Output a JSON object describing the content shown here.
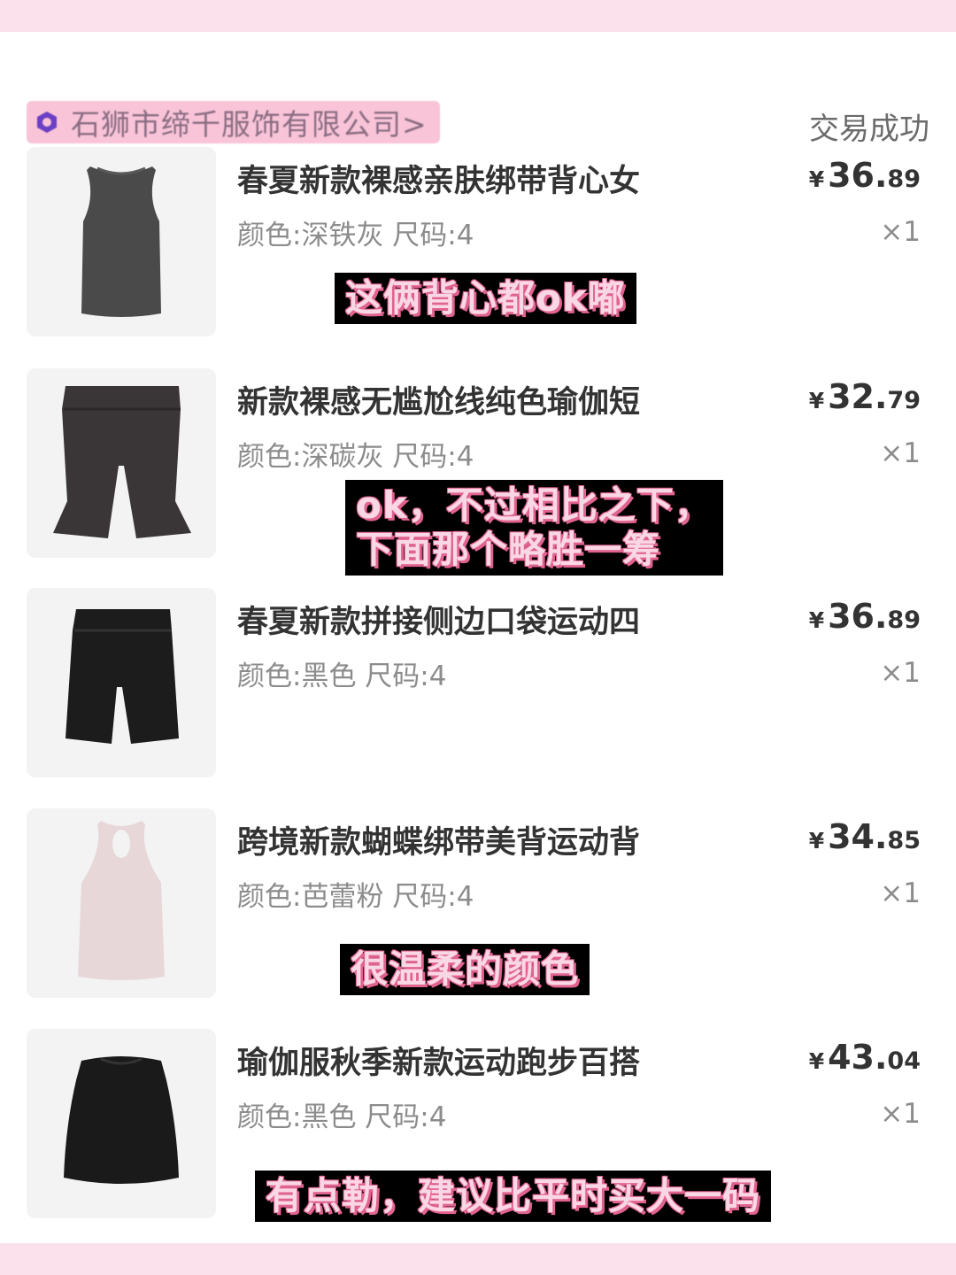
{
  "shop": {
    "name": "石狮市缔千服饰有限公司>",
    "status": "交易成功",
    "icon": "shop-icon"
  },
  "items": [
    {
      "title": "春夏新款裸感亲肤绑带背心女",
      "spec": "颜色:深铁灰 尺码:4",
      "price_symbol": "¥",
      "price_int": "36.",
      "price_dec": "89",
      "qty": "×1",
      "thumb": "tank-top-dark-gray",
      "color": "#4a4a4a"
    },
    {
      "title": "新款裸感无尴尬线纯色瑜伽短",
      "spec": "颜色:深碳灰 尺码:4",
      "price_symbol": "¥",
      "price_int": "32.",
      "price_dec": "79",
      "qty": "×1",
      "thumb": "shorts-charcoal",
      "color": "#3a3536"
    },
    {
      "title": "春夏新款拼接侧边口袋运动四",
      "spec": "颜色:黑色 尺码:4",
      "price_symbol": "¥",
      "price_int": "36.",
      "price_dec": "89",
      "qty": "×1",
      "thumb": "shorts-black",
      "color": "#1c1c1c"
    },
    {
      "title": "跨境新款蝴蝶绑带美背运动背",
      "spec": "颜色:芭蕾粉 尺码:4",
      "price_symbol": "¥",
      "price_int": "34.",
      "price_dec": "85",
      "qty": "×1",
      "thumb": "tank-top-ballet-pink",
      "color": "#e7d7d9"
    },
    {
      "title": "瑜伽服秋季新款运动跑步百搭",
      "spec": "颜色:黑色 尺码:4",
      "price_symbol": "¥",
      "price_int": "43.",
      "price_dec": "04",
      "qty": "×1",
      "thumb": "crop-top-black",
      "color": "#1a1a1a"
    }
  ],
  "annotations": [
    {
      "line1": "这俩背心都ok嘟"
    },
    {
      "line1": "ok，不过相比之下，",
      "line2": "下面那个略胜一筹"
    },
    {
      "line1": "很温柔的颜色"
    },
    {
      "line1": "有点勒，建议比平时买大一码"
    }
  ],
  "colors": {
    "page_background": "#fbe1ec",
    "card": "#ffffff",
    "annotation_bg": "#000000",
    "annotation_text": "#fad7e5",
    "annotation_shadow": "#e0628f"
  }
}
